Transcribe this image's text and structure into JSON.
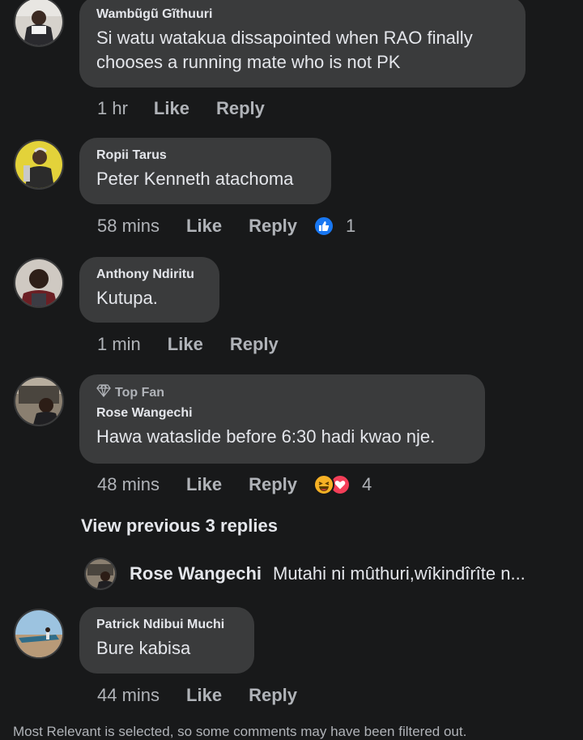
{
  "colors": {
    "background": "#18191a",
    "bubble": "#3a3b3c",
    "text": "#e4e6eb",
    "muted": "#b0b3b8",
    "like_blue": "#1877f2",
    "love_red": "#f33e58",
    "haha_yellow": "#f7b125"
  },
  "comments": [
    {
      "author": "Wambũgũ Gĩthuuri",
      "text": "Si watu watakua dissapointed when RAO finally chooses a running mate who is not PK",
      "time": "1 hr",
      "like": "Like",
      "reply": "Reply"
    },
    {
      "author": "Ropii Tarus",
      "text": "Peter Kenneth atachoma",
      "time": "58 mins",
      "like": "Like",
      "reply": "Reply",
      "reaction_count": "1",
      "reaction_icon": "like-icon"
    },
    {
      "author": "Anthony Ndiritu",
      "text": "Kutupa.",
      "time": "1 min",
      "like": "Like",
      "reply": "Reply"
    },
    {
      "badge": "Top Fan",
      "author": "Rose Wangechi",
      "text": "Hawa wataslide before 6:30 hadi kwao nje.",
      "time": "48 mins",
      "like": "Like",
      "reply": "Reply",
      "reaction_count": "4",
      "reaction_icons": [
        "haha-icon",
        "love-icon"
      ]
    },
    {
      "author": "Patrick Ndibui Muchi",
      "text": "Bure kabisa",
      "time": "44 mins",
      "like": "Like",
      "reply": "Reply"
    }
  ],
  "view_previous": "View previous 3 replies",
  "reply_preview": {
    "author": "Rose Wangechi",
    "snippet": "Mutahi ni mûthuri,wîkindîrîte n..."
  },
  "footer_note": "Most Relevant is selected, so some comments may have been filtered out."
}
